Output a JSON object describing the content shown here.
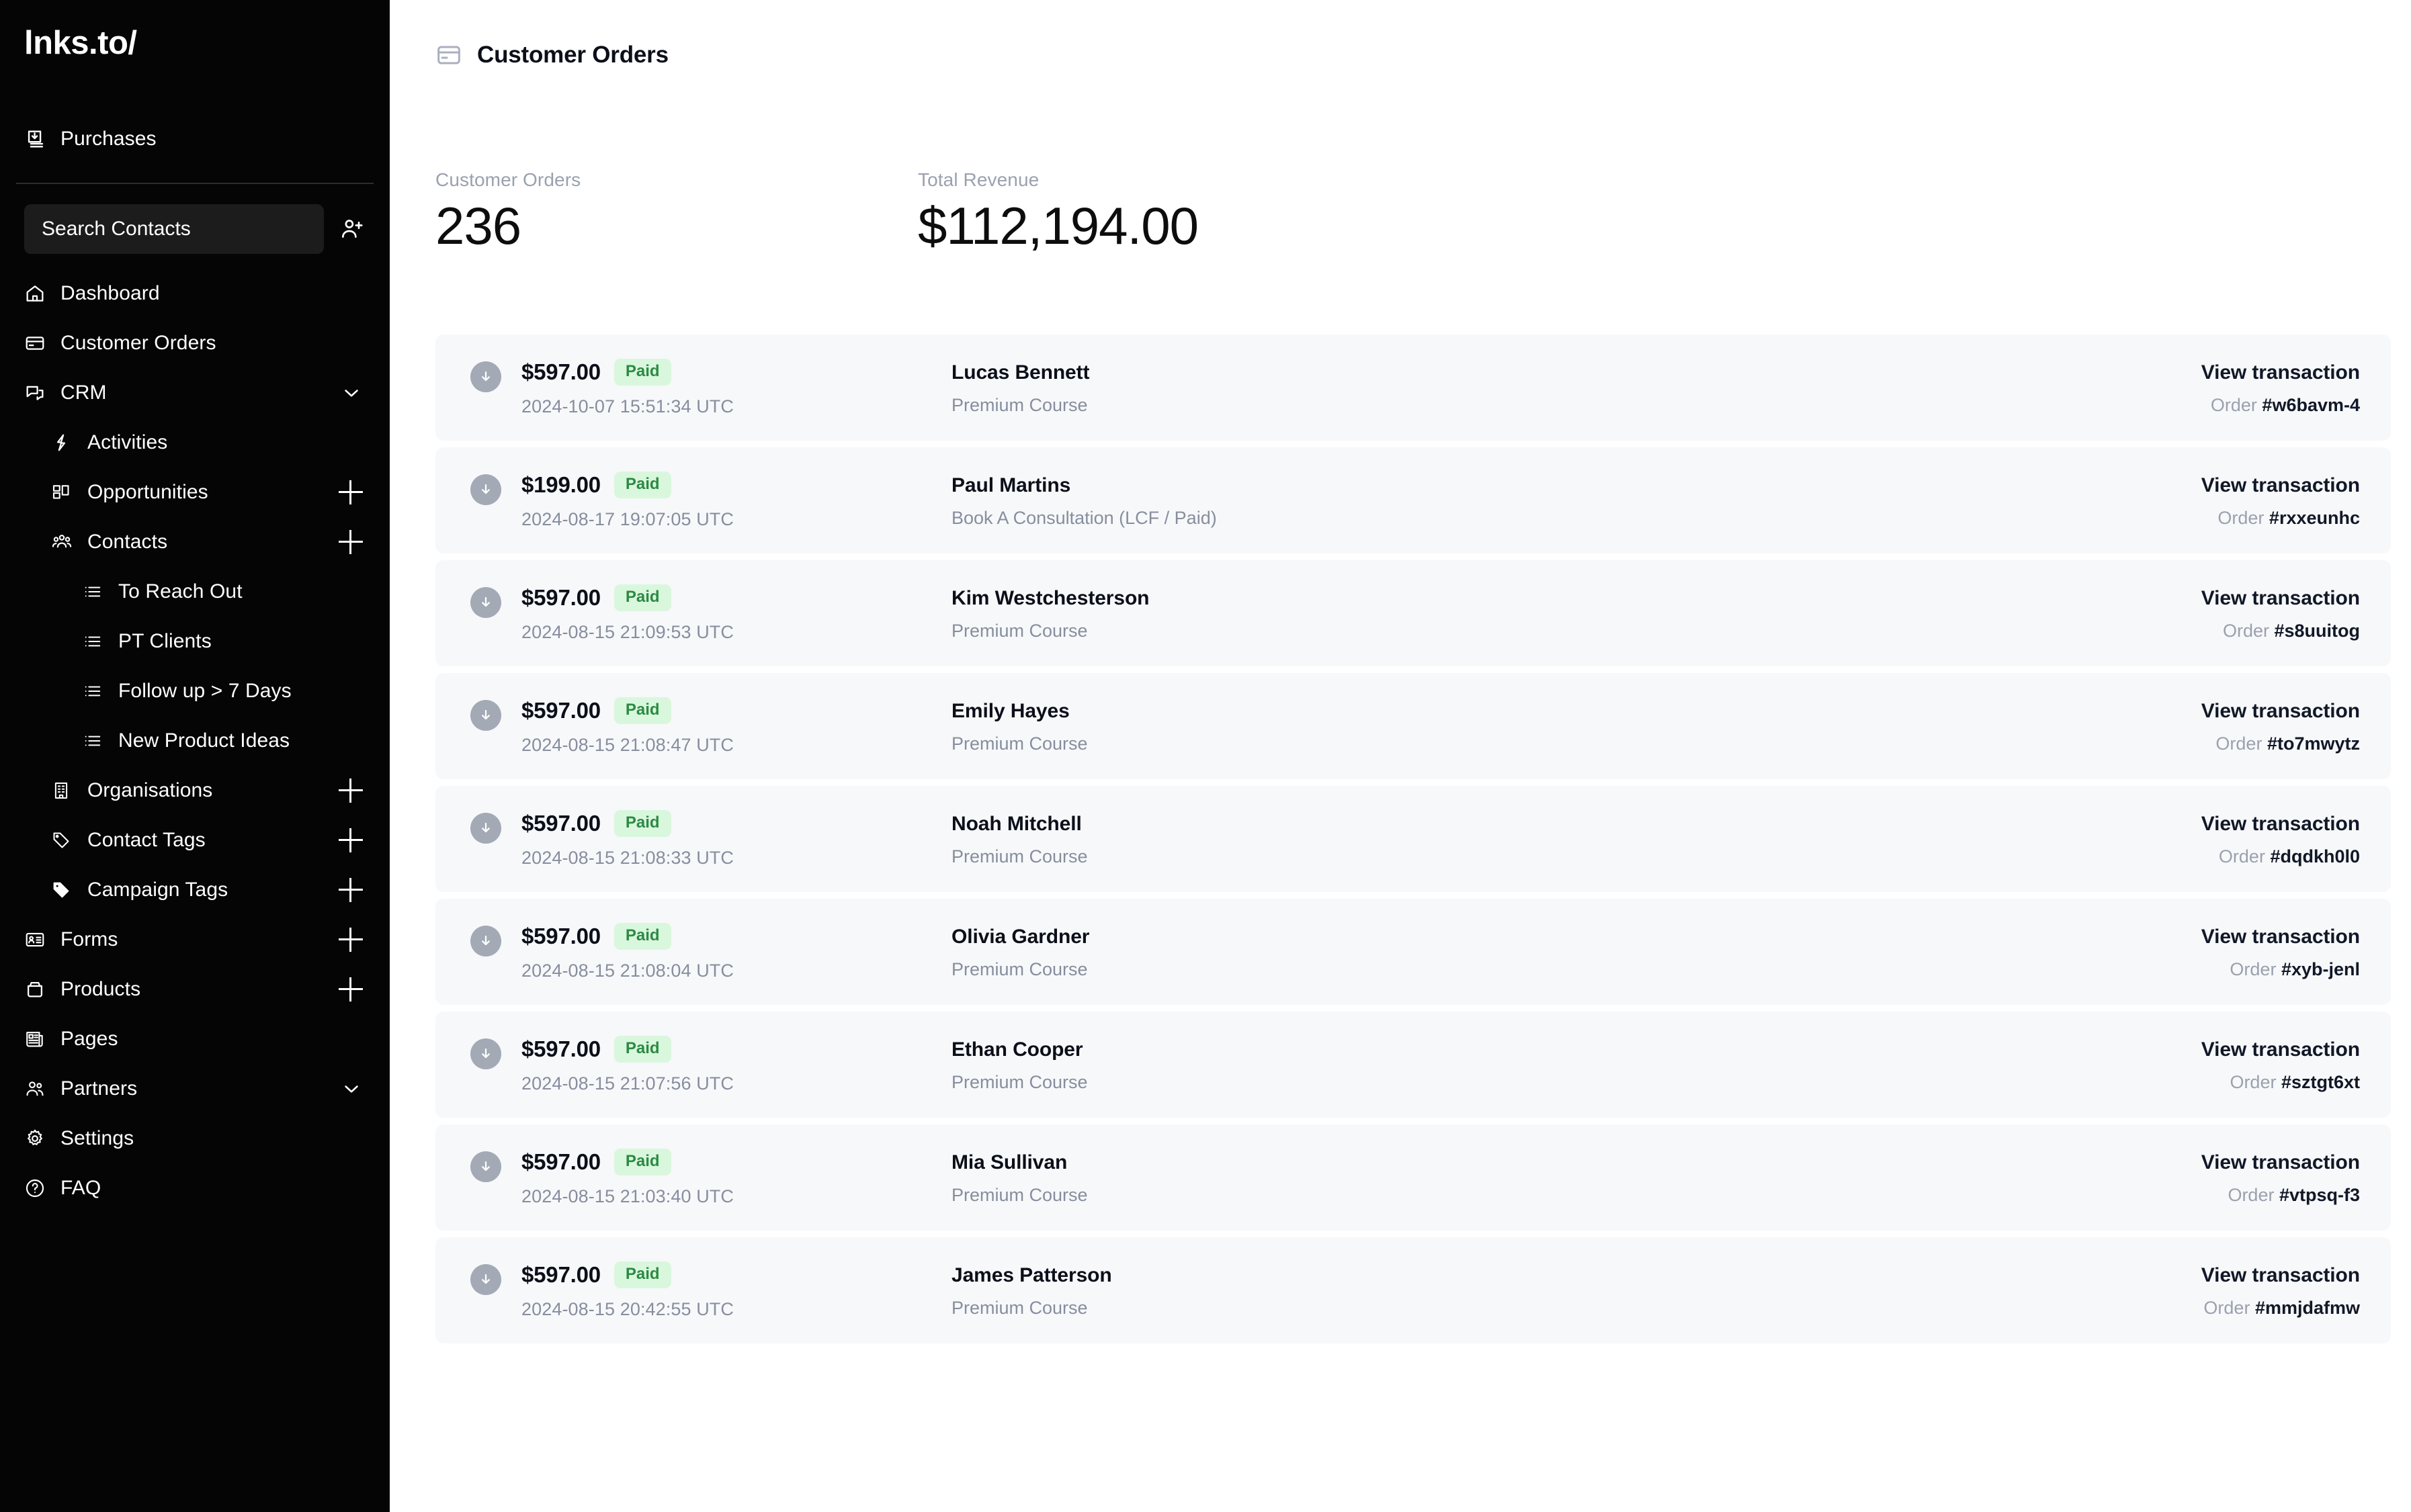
{
  "sidebar": {
    "brand": "lnks.to/",
    "top_items": [
      {
        "label": "Purchases",
        "icon": "download-box-icon"
      }
    ],
    "search": {
      "placeholder": "Search Contacts",
      "value": "",
      "add_icon": "add-user-icon"
    },
    "items": [
      {
        "label": "Dashboard",
        "icon": "home-icon",
        "indent": 0,
        "trail": ""
      },
      {
        "label": "Customer Orders",
        "icon": "credit-card-icon",
        "indent": 0,
        "trail": ""
      },
      {
        "label": "CRM",
        "icon": "chat-icon",
        "indent": 0,
        "trail": "chevron-down"
      },
      {
        "label": "Activities",
        "icon": "lightning-icon",
        "indent": 1,
        "trail": ""
      },
      {
        "label": "Opportunities",
        "icon": "kanban-icon",
        "indent": 1,
        "trail": "plus"
      },
      {
        "label": "Contacts",
        "icon": "people-group-icon",
        "indent": 1,
        "trail": "plus"
      },
      {
        "label": "To Reach Out",
        "icon": "list-icon",
        "indent": 2,
        "trail": ""
      },
      {
        "label": "PT Clients",
        "icon": "list-icon",
        "indent": 2,
        "trail": ""
      },
      {
        "label": "Follow up > 7 Days",
        "icon": "list-icon",
        "indent": 2,
        "trail": ""
      },
      {
        "label": "New Product Ideas",
        "icon": "list-icon",
        "indent": 2,
        "trail": ""
      },
      {
        "label": "Organisations",
        "icon": "building-icon",
        "indent": 1,
        "trail": "plus"
      },
      {
        "label": "Contact Tags",
        "icon": "tag-outline-icon",
        "indent": 1,
        "trail": "plus"
      },
      {
        "label": "Campaign Tags",
        "icon": "tag-filled-icon",
        "indent": 1,
        "trail": "plus"
      },
      {
        "label": "Forms",
        "icon": "id-card-icon",
        "indent": 0,
        "trail": "plus"
      },
      {
        "label": "Products",
        "icon": "box-icon",
        "indent": 0,
        "trail": "plus"
      },
      {
        "label": "Pages",
        "icon": "newspaper-icon",
        "indent": 0,
        "trail": ""
      },
      {
        "label": "Partners",
        "icon": "users-icon",
        "indent": 0,
        "trail": "chevron-down"
      },
      {
        "label": "Settings",
        "icon": "gear-icon",
        "indent": 0,
        "trail": ""
      },
      {
        "label": "FAQ",
        "icon": "question-circle-icon",
        "indent": 0,
        "trail": ""
      }
    ]
  },
  "header": {
    "title": "Customer Orders",
    "icon": "credit-card-icon"
  },
  "stats": [
    {
      "label": "Customer Orders",
      "value": "236"
    },
    {
      "label": "Total Revenue",
      "value": "$112,194.00"
    }
  ],
  "orders_labels": {
    "view_transaction": "View transaction",
    "order_prefix": "Order "
  },
  "orders": [
    {
      "amount": "$597.00",
      "status": "Paid",
      "date": "2024-10-07 15:51:34 UTC",
      "customer": "Lucas Bennett",
      "product": "Premium Course",
      "order_id": "#w6bavm-4"
    },
    {
      "amount": "$199.00",
      "status": "Paid",
      "date": "2024-08-17 19:07:05 UTC",
      "customer": "Paul Martins",
      "product": "Book A Consultation (LCF / Paid)",
      "order_id": "#rxxeunhc"
    },
    {
      "amount": "$597.00",
      "status": "Paid",
      "date": "2024-08-15 21:09:53 UTC",
      "customer": "Kim Westchesterson",
      "product": "Premium Course",
      "order_id": "#s8uuitog"
    },
    {
      "amount": "$597.00",
      "status": "Paid",
      "date": "2024-08-15 21:08:47 UTC",
      "customer": "Emily Hayes",
      "product": "Premium Course",
      "order_id": "#to7mwytz"
    },
    {
      "amount": "$597.00",
      "status": "Paid",
      "date": "2024-08-15 21:08:33 UTC",
      "customer": "Noah Mitchell",
      "product": "Premium Course",
      "order_id": "#dqdkh0l0"
    },
    {
      "amount": "$597.00",
      "status": "Paid",
      "date": "2024-08-15 21:08:04 UTC",
      "customer": "Olivia Gardner",
      "product": "Premium Course",
      "order_id": "#xyb-jenl"
    },
    {
      "amount": "$597.00",
      "status": "Paid",
      "date": "2024-08-15 21:07:56 UTC",
      "customer": "Ethan Cooper",
      "product": "Premium Course",
      "order_id": "#sztgt6xt"
    },
    {
      "amount": "$597.00",
      "status": "Paid",
      "date": "2024-08-15 21:03:40 UTC",
      "customer": "Mia Sullivan",
      "product": "Premium Course",
      "order_id": "#vtpsq-f3"
    },
    {
      "amount": "$597.00",
      "status": "Paid",
      "date": "2024-08-15 20:42:55 UTC",
      "customer": "James Patterson",
      "product": "Premium Course",
      "order_id": "#mmjdafmw"
    }
  ],
  "colors": {
    "sidebar_bg": "#050505",
    "row_bg": "#f7f8fa",
    "paid_bg": "#d9f7dd",
    "paid_text": "#2c8a43",
    "muted": "#868e9e",
    "text": "#0b0f19"
  }
}
